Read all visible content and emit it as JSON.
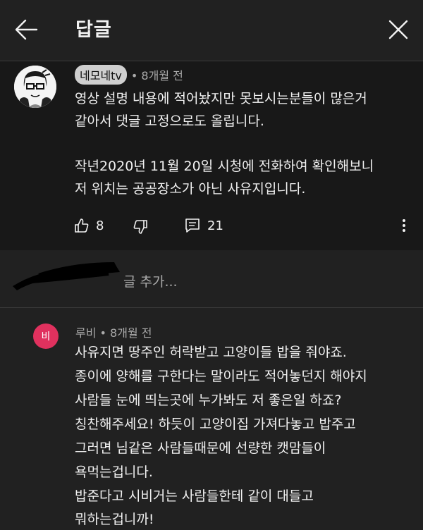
{
  "header": {
    "title": "답글",
    "back_icon": "arrow-left-icon",
    "close_icon": "close-icon"
  },
  "pinned_comment": {
    "author": "네모네tv",
    "time": "• 8개월 전",
    "lines": [
      "영상 설명 내용에 적어놨지만 못보시는분들이 많은거",
      "같아서 댓글 고정으로도 올립니다.",
      "",
      "작년2020년 11월 20일 시청에 전화하여 확인해보니",
      "저 위치는 공공장소가 아닌 사유지입니다."
    ],
    "likes": "8",
    "replies": "21"
  },
  "add_reply": {
    "placeholder": "글 추가..."
  },
  "reply": {
    "avatar_letter": "비",
    "avatar_color": "#e0315e",
    "meta": "루비 • 8개월 전",
    "lines": [
      "사유지면 땅주인 허락받고 고양이들 밥을 줘야죠.",
      "종이에 양해를 구한다는 말이라도 적어놓던지 해야지",
      "사람들 눈에 띄는곳에 누가봐도 저 좋은일 하죠?",
      "칭찬해주세요! 하듯이 고양이집 가져다놓고 밥주고",
      "그러면 님같은 사람들때문에 선량한 캣맘들이",
      "욕먹는겁니다.",
      "밥준다고 시비거는 사람들한테 같이 대들고",
      "뭐하는겁니까!"
    ]
  }
}
